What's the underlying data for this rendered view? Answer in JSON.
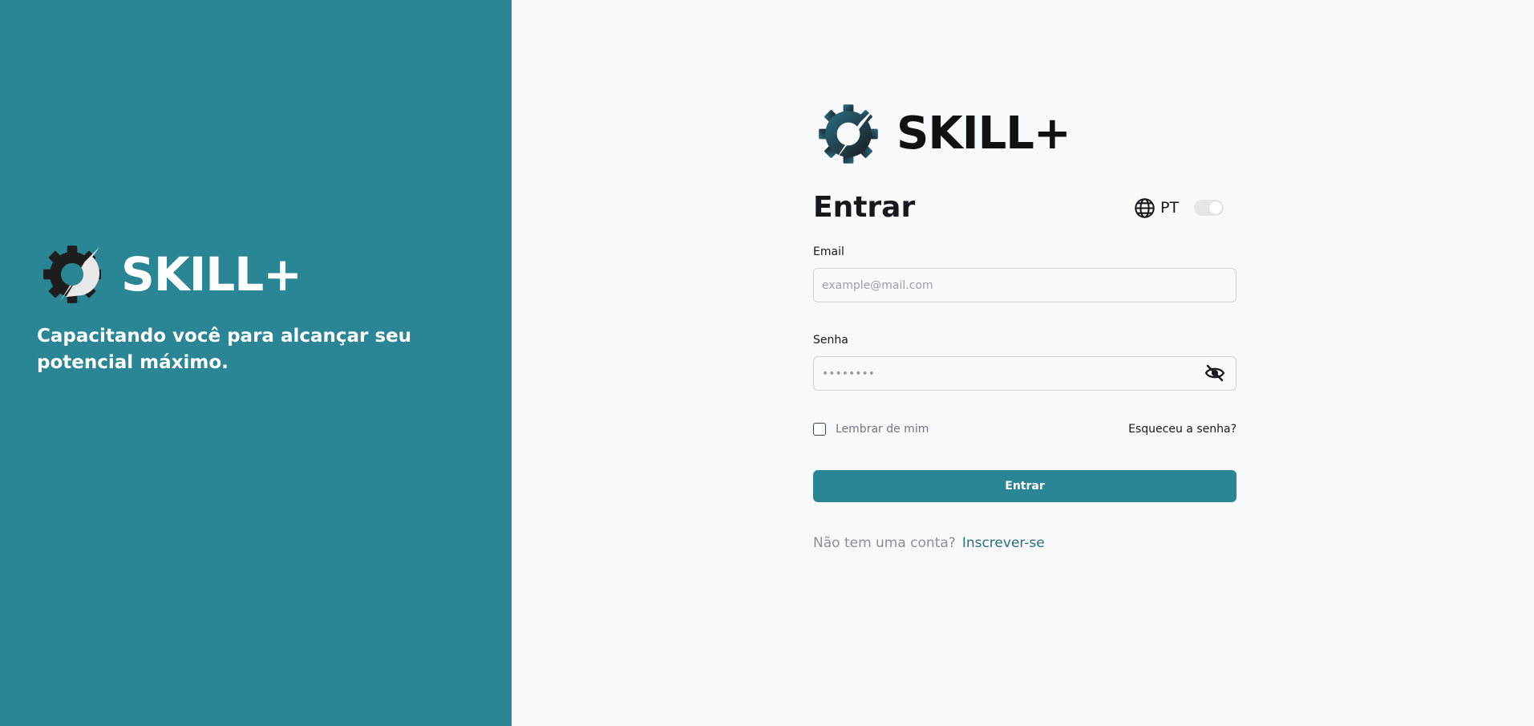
{
  "brand": {
    "name": "SKILL+",
    "tagline": "Capacitando você para alcançar seu potencial máximo."
  },
  "login": {
    "title": "Entrar",
    "language": "PT",
    "email_label": "Email",
    "email_placeholder": "example@mail.com",
    "password_label": "Senha",
    "password_placeholder": "••••••••",
    "remember_label": "Lembrar de mim",
    "forgot_label": "Esqueceu a senha?",
    "submit_label": "Entrar",
    "signup_prompt": "Não tem uma conta?",
    "signup_link": "Inscrever-se"
  },
  "colors": {
    "accent": "#2a8594",
    "background": "#f8f9fb",
    "text": "#15181c"
  },
  "icons": [
    "gear-logo-icon",
    "globe-icon",
    "eye-off-icon"
  ]
}
